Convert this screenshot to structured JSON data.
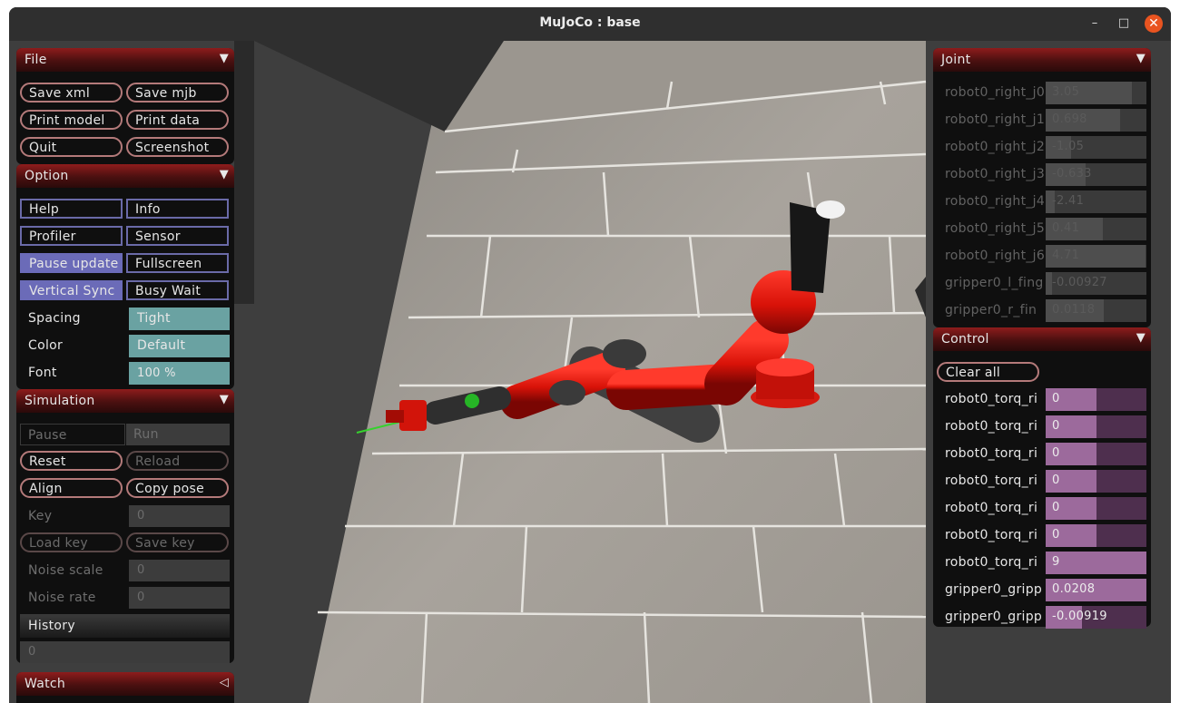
{
  "window": {
    "title": "MuJoCo : base",
    "minimize": "–",
    "maximize": "□",
    "close": "✕"
  },
  "file": {
    "title": "File",
    "arrow": "▼",
    "save_xml": "Save xml",
    "save_mjb": "Save mjb",
    "print_model": "Print model",
    "print_data": "Print data",
    "quit": "Quit",
    "screenshot": "Screenshot"
  },
  "option": {
    "title": "Option",
    "arrow": "▼",
    "help": "Help",
    "info": "Info",
    "profiler": "Profiler",
    "sensor": "Sensor",
    "pause_update": "Pause update",
    "fullscreen": "Fullscreen",
    "vertical_sync": "Vertical Sync",
    "busy_wait": "Busy Wait",
    "spacing_label": "Spacing",
    "spacing_value": "Tight",
    "color_label": "Color",
    "color_value": "Default",
    "font_label": "Font",
    "font_value": "100 %"
  },
  "simulation": {
    "title": "Simulation",
    "arrow": "▼",
    "pause": "Pause",
    "run": "Run",
    "reset": "Reset",
    "reload": "Reload",
    "align": "Align",
    "copy_pose": "Copy pose",
    "key_label": "Key",
    "key_value": "0",
    "load_key": "Load key",
    "save_key": "Save key",
    "noise_scale_label": "Noise scale",
    "noise_scale_value": "0",
    "noise_rate_label": "Noise rate",
    "noise_rate_value": "0",
    "history_label": "History",
    "history_value": "0"
  },
  "watch": {
    "title": "Watch",
    "arrow": "◁"
  },
  "joint": {
    "title": "Joint",
    "arrow": "▼",
    "items": [
      {
        "name": "robot0_right_j0",
        "value": "3.05",
        "fill": 0.86
      },
      {
        "name": "robot0_right_j1",
        "value": "0.698",
        "fill": 0.74
      },
      {
        "name": "robot0_right_j2",
        "value": "-1.05",
        "fill": 0.25
      },
      {
        "name": "robot0_right_j3",
        "value": "-0.633",
        "fill": 0.4
      },
      {
        "name": "robot0_right_j4",
        "value": "-2.41",
        "fill": 0.09
      },
      {
        "name": "robot0_right_j5",
        "value": "0.41",
        "fill": 0.57
      },
      {
        "name": "robot0_right_j6",
        "value": "4.71",
        "fill": 0.99
      },
      {
        "name": "gripper0_l_fing",
        "value": "-0.00927",
        "fill": 0.06
      },
      {
        "name": "gripper0_r_fin",
        "value": "0.0118",
        "fill": 0.58
      }
    ]
  },
  "control": {
    "title": "Control",
    "arrow": "▼",
    "clear_all": "Clear all",
    "items": [
      {
        "name": "robot0_torq_ri",
        "value": "0",
        "fill": 0.5
      },
      {
        "name": "robot0_torq_ri",
        "value": "0",
        "fill": 0.5
      },
      {
        "name": "robot0_torq_ri",
        "value": "0",
        "fill": 0.5
      },
      {
        "name": "robot0_torq_ri",
        "value": "0",
        "fill": 0.5
      },
      {
        "name": "robot0_torq_ri",
        "value": "0",
        "fill": 0.5
      },
      {
        "name": "robot0_torq_ri",
        "value": "0",
        "fill": 0.5
      },
      {
        "name": "robot0_torq_ri",
        "value": "9",
        "fill": 1.0
      },
      {
        "name": "gripper0_gripp",
        "value": "0.0208",
        "fill": 1.0
      },
      {
        "name": "gripper0_gripp",
        "value": "-0.00919",
        "fill": 0.36
      }
    ]
  }
}
